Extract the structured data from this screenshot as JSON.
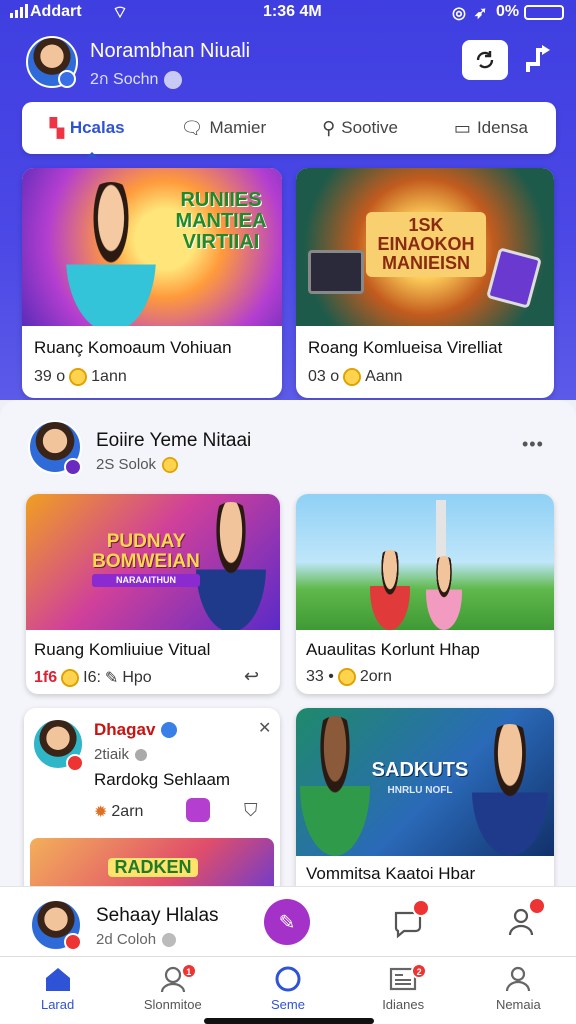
{
  "status": {
    "carrier": "Addart",
    "time": "1:36 4M",
    "battery": "0%"
  },
  "profile": {
    "name": "Norambhan Niuali",
    "sub": "2ก Sochn"
  },
  "tabs": [
    {
      "label": "Hcalas",
      "icon": "grid-icon",
      "active": true
    },
    {
      "label": "Mamier",
      "icon": "chat-icon",
      "active": false
    },
    {
      "label": "Sootive",
      "icon": "search-icon",
      "active": false
    },
    {
      "label": "Idensa",
      "icon": "message-icon",
      "active": false
    }
  ],
  "top_cards": [
    {
      "art_text": "RUNIIES MANTIEA VIRTIIAI",
      "caption": "Ruanç Komoaum Vohiuan",
      "count": "39 o",
      "meta": "1ann"
    },
    {
      "art_text": "1SK EINAOKOH MANIEISN",
      "caption": "Roang Komlueisa Virelliat",
      "count": "03 o",
      "meta": "Aann"
    }
  ],
  "post": {
    "title": "Eoiire Yeme Nitaai",
    "sub": "2S Solok",
    "more": "•••"
  },
  "grid_cards": [
    {
      "art_text": "PUDNAY BOMWEIAN",
      "art_sub": "NARAAITHUN",
      "caption": "Ruang Komliuiue Vitual",
      "count": "1f6",
      "meta": "I6:",
      "action": "Hpo"
    },
    {
      "caption": "Auaulitas Korlunt Hhap",
      "count": "33 •",
      "meta": "2orn"
    }
  ],
  "chat_card": {
    "name": "Dhagav",
    "sub": "2tiaik",
    "text": "Rardokg Sehlaam",
    "time": "2arn",
    "art_text": "RADKEN"
  },
  "video_card": {
    "art_text": "SADKUTS",
    "art_sub": "HNRLU NOFL",
    "caption": "Vommitsa Kaatoi Hbar"
  },
  "composer": {
    "name": "Sehaay Hlalas",
    "sub": "2d Coloh"
  },
  "bottom_nav": [
    {
      "label": "Larad",
      "icon": "home-icon",
      "active": true,
      "badge": ""
    },
    {
      "label": "Slonmitoe",
      "icon": "community-icon",
      "active": false,
      "badge": "1"
    },
    {
      "label": "Seme",
      "icon": "circle-icon",
      "active": false,
      "badge": ""
    },
    {
      "label": "Idianes",
      "icon": "news-icon",
      "active": false,
      "badge": "2"
    },
    {
      "label": "Nemaia",
      "icon": "user-icon",
      "active": false,
      "badge": ""
    }
  ],
  "colors": {
    "primary": "#4442e2",
    "accent": "#2f53d6",
    "badge": "#e33333",
    "fab": "#a432c8"
  }
}
